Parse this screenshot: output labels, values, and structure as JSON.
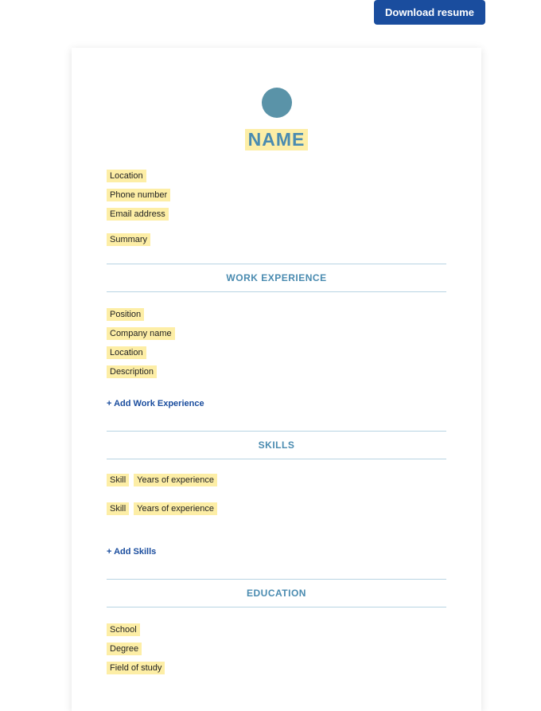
{
  "header": {
    "download_label": "Download resume"
  },
  "resume": {
    "name_placeholder": "NAME",
    "location_placeholder": "Location",
    "phone_placeholder": "Phone number",
    "email_placeholder": "Email address",
    "summary_placeholder": "Summary",
    "sections": {
      "work_experience": {
        "title": "WORK EXPERIENCE",
        "position_placeholder": "Position",
        "company_placeholder": "Company name",
        "location_placeholder": "Location",
        "description_placeholder": "Description",
        "add_label": "+ Add Work Experience"
      },
      "skills": {
        "title": "SKILLS",
        "skill_placeholder": "Skill",
        "years_placeholder": "Years of experience",
        "add_label": "+ Add Skills"
      },
      "education": {
        "title": "EDUCATION",
        "school_placeholder": "School",
        "degree_placeholder": "Degree",
        "field_placeholder": "Field of study"
      }
    }
  }
}
